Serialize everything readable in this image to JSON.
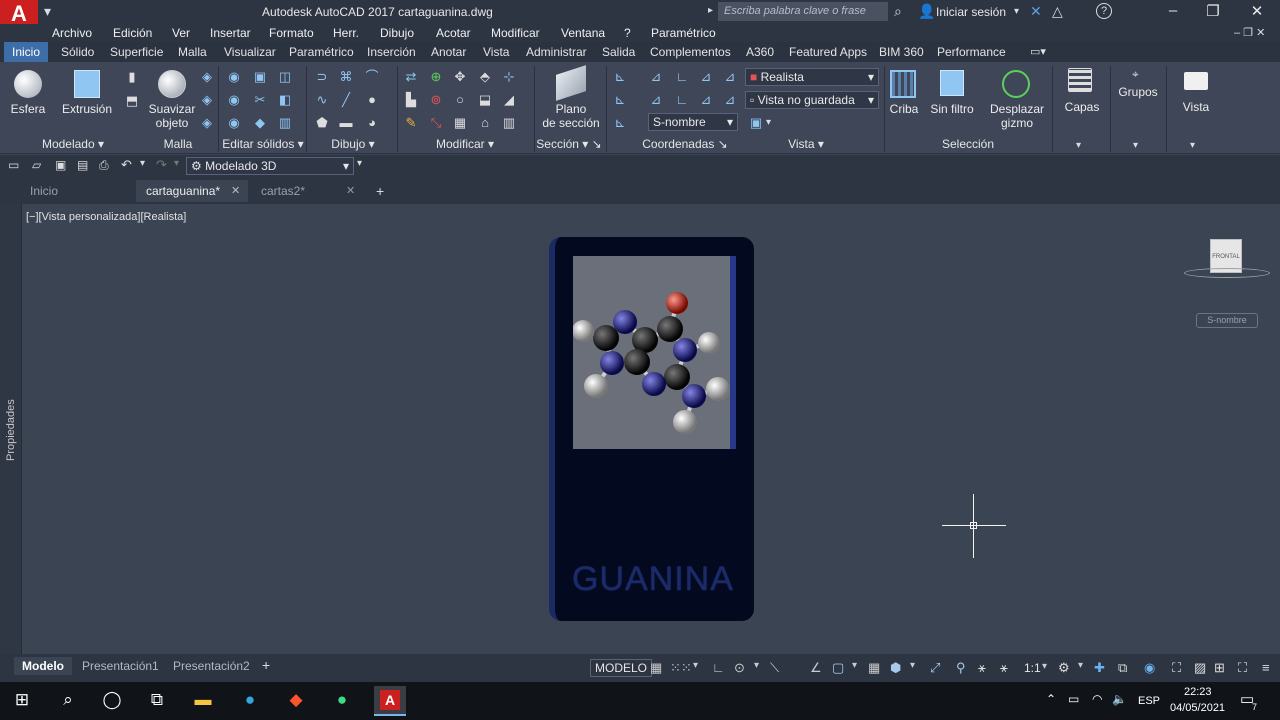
{
  "titlebar": {
    "logo_letter": "A",
    "title": "Autodesk AutoCAD 2017    cartaguanina.dwg",
    "search_placeholder": "Escriba palabra clave o frase",
    "signin": "Iniciar sesión",
    "help": "?"
  },
  "menu": [
    "Archivo",
    "Edición",
    "Ver",
    "Insertar",
    "Formato",
    "Herr.",
    "Dibujo",
    "Acotar",
    "Modificar",
    "Ventana",
    "?",
    "Paramétrico"
  ],
  "ribbon_tabs": [
    "Inicio",
    "Sólido",
    "Superficie",
    "Malla",
    "Visualizar",
    "Paramétrico",
    "Inserción",
    "Anotar",
    "Vista",
    "Administrar",
    "Salida",
    "Complementos",
    "A360",
    "Featured Apps",
    "BIM 360",
    "Performance"
  ],
  "ribbon": {
    "esfera": "Esfera",
    "extrusion": "Extrusión",
    "suavizar_1": "Suavizar",
    "suavizar_2": "objeto",
    "plano_1": "Plano",
    "plano_2": "de sección",
    "realista": "Realista",
    "vista_no_guardada": "Vista no guardada",
    "s_nombre": "S-nombre",
    "criba": "Criba",
    "sin_filtro": "Sin filtro",
    "desplazar_1": "Desplazar",
    "desplazar_2": "gizmo",
    "capas": "Capas",
    "grupos": "Grupos",
    "vista": "Vista",
    "panels": {
      "modelado": "Modelado",
      "malla": "Malla",
      "editar_solidos": "Editar sólidos",
      "dibujo": "Dibujo",
      "modificar": "Modificar",
      "seccion": "Sección",
      "coordenadas": "Coordenadas",
      "vista": "Vista",
      "seleccion": "Selección"
    }
  },
  "qat": {
    "workspace": "Modelado 3D"
  },
  "doc_tabs": [
    "Inicio",
    "cartaguanina*",
    "cartas2*"
  ],
  "viewport": {
    "view_label": "[−][Vista personalizada][Realista]",
    "side_palette": "Propiedades",
    "card_text": "GUANINA",
    "viewcube_face": "FRONTAL",
    "ucs": "S-nombre"
  },
  "layout_tabs": [
    "Modelo",
    "Presentación1",
    "Presentación2"
  ],
  "status": {
    "mode": "MODELO",
    "scale": "1:1"
  },
  "taskbar": {
    "lang": "ESP",
    "time": "22:23",
    "date": "04/05/2021",
    "notif_count": "7"
  },
  "colors": {
    "accent": "#3d6ea8",
    "card": "#030a1f",
    "logo": "#cc1f1f"
  }
}
